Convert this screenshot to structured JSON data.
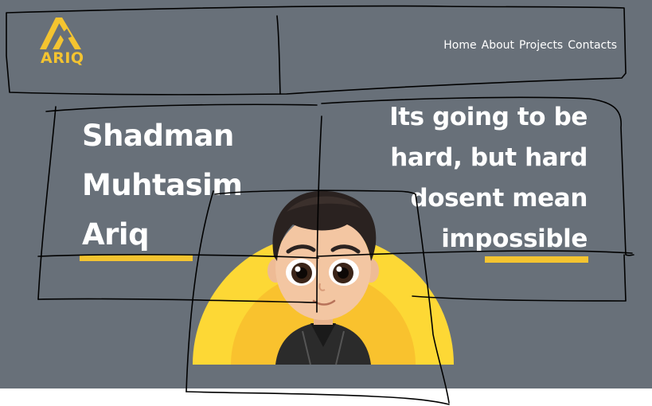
{
  "brand": {
    "name": "ARIQ",
    "accent_color": "#f4c430",
    "background_color": "#687079"
  },
  "nav": {
    "items": [
      "Home",
      "About",
      "Projects",
      "Contacts"
    ]
  },
  "hero": {
    "name_lines": [
      "Shadman",
      "Muhtasim",
      "Ariq"
    ],
    "quote_lines": [
      "Its going to be",
      "hard, but hard",
      "dosent mean",
      "impossible"
    ]
  },
  "avatar": {
    "icon": "cartoon-avatar"
  }
}
